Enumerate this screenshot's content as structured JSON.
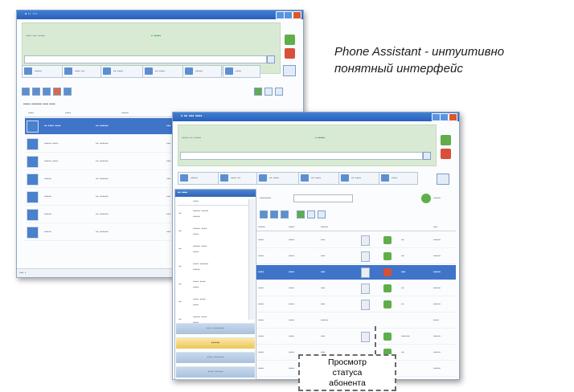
{
  "headline": {
    "line1": "Phone Assistant - интуитивно",
    "line2": "понятный интерфейс"
  },
  "callout": {
    "line1": "Просмотр",
    "line2": "статуса",
    "line3": "абонента"
  },
  "colors": {
    "titlebar": "#2b5fb8",
    "selection": "#3f74c9",
    "header_green": "#d8ead4",
    "nav_active": "#eec55a"
  },
  "icons": {
    "phone": "phone-icon",
    "contact": "contact-icon",
    "search": "search-icon"
  }
}
